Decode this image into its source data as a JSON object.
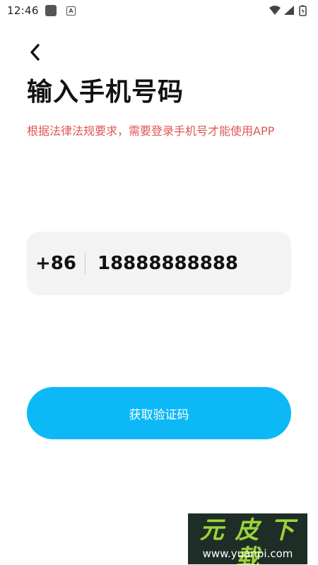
{
  "status_bar": {
    "time": "12:46",
    "notification_glyph": "A"
  },
  "page": {
    "title": "输入手机号码",
    "notice": "根据法律法规要求，需要登录手机号才能使用APP"
  },
  "phone": {
    "country_code": "+86",
    "number": "18888888888"
  },
  "submit": {
    "label": "获取验证码"
  },
  "watermark": {
    "title": "元 皮 下 载",
    "url": "www.yuanpi.com"
  },
  "colors": {
    "accent": "#0db8f7",
    "notice": "#e05555",
    "input_bg": "#f3f3f3"
  },
  "icons": [
    "back-arrow-icon",
    "wifi-icon",
    "signal-icon",
    "battery-icon"
  ]
}
